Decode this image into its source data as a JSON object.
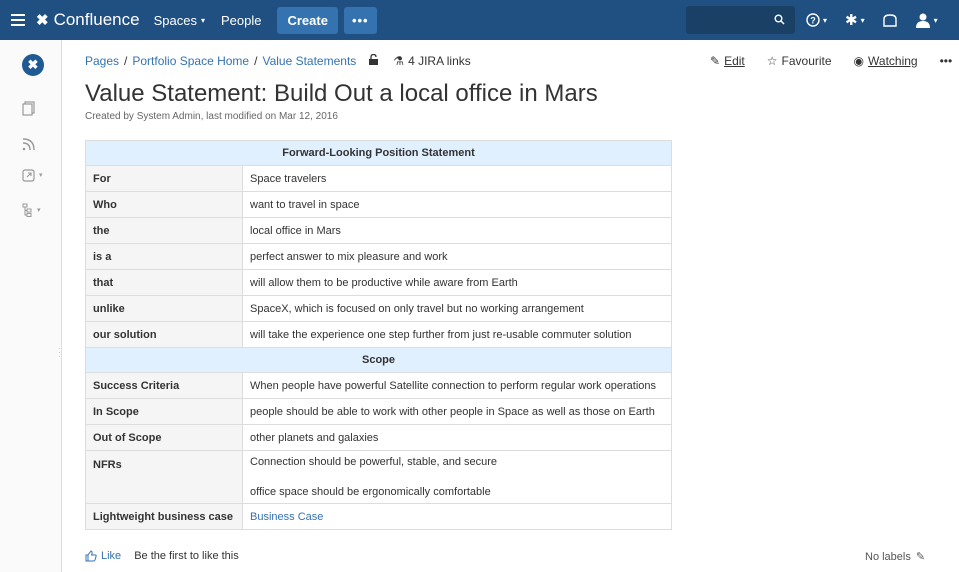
{
  "topnav": {
    "product": "Confluence",
    "spaces": "Spaces",
    "people": "People",
    "create": "Create",
    "more": "•••"
  },
  "breadcrumb": {
    "pages": "Pages",
    "sep": "/",
    "space_home": "Portfolio Space Home",
    "current": "Value Statements",
    "jira_links": "4 JIRA links"
  },
  "actions": {
    "edit": "Edit",
    "favourite": "Favourite",
    "watching": "Watching",
    "more": "•••"
  },
  "page": {
    "title": "Value Statement: Build Out a local office in Mars",
    "meta": "Created by System Admin, last modified on Mar 12, 2016"
  },
  "table": {
    "header1": "Forward-Looking Position Statement",
    "rows1": [
      {
        "label": "For",
        "value": "Space travelers"
      },
      {
        "label": "Who",
        "value": "want to travel in space"
      },
      {
        "label": "the",
        "value": "local office in Mars"
      },
      {
        "label": "is a",
        "value": "perfect answer to mix pleasure and work"
      },
      {
        "label": "that",
        "value": "will allow them to be productive while aware from Earth"
      },
      {
        "label": "unlike",
        "value": "SpaceX, which is focused on only travel but no working arrangement"
      },
      {
        "label": "our solution",
        "value": "will take the experience one step further from just re-usable commuter solution"
      }
    ],
    "header2": "Scope",
    "rows2": [
      {
        "label": "Success Criteria",
        "value": "When people have powerful Satellite connection to perform regular work operations"
      },
      {
        "label": "In Scope",
        "value": "people should be able to work with other people in Space as well as those on Earth"
      },
      {
        "label": "Out of Scope",
        "value": "other planets and galaxies"
      }
    ],
    "nfrs_label": "NFRs",
    "nfrs": [
      "Connection should be powerful, stable, and secure",
      "office space should be ergonomically comfortable"
    ],
    "business_case_label": "Lightweight business case",
    "business_case_link": "Business Case"
  },
  "footer": {
    "like": "Like",
    "first_like": "Be the first to like this",
    "labels": "No labels"
  },
  "colors": {
    "nav": "#205081",
    "accent": "#3572b0",
    "table_header": "#e0f0ff"
  }
}
